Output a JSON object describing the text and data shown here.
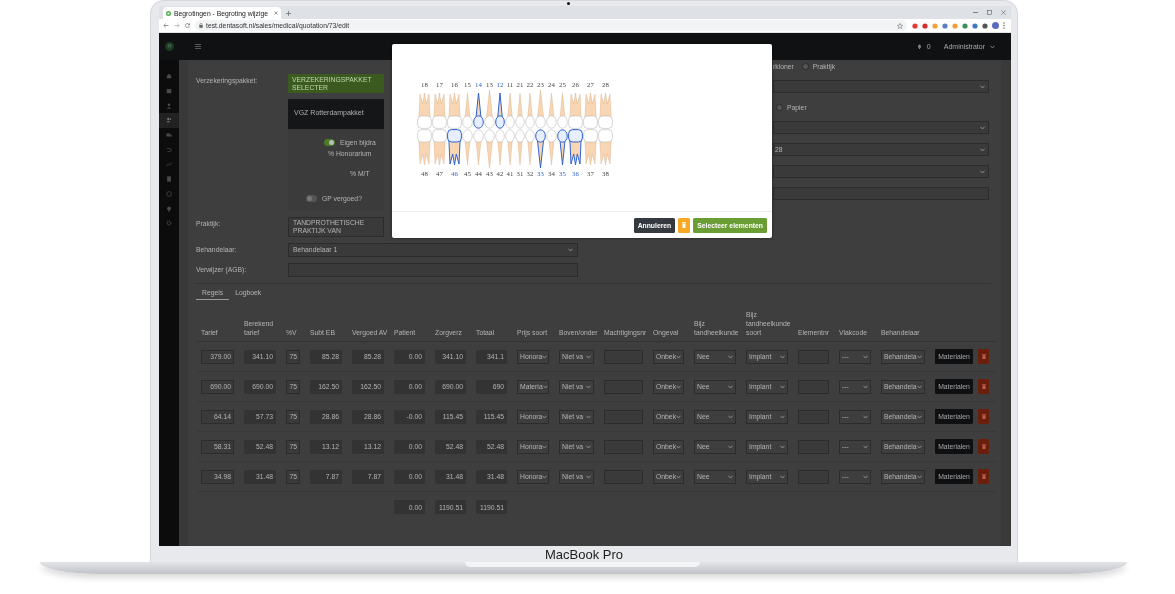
{
  "browser": {
    "tab_title": "Begrotingen - Begroting wijzige",
    "url": "test.dentasoft.nl/sales/medical/quotation/73/edit"
  },
  "navbar": {
    "notification_count": "0",
    "user": "Administrator"
  },
  "sidebar": {
    "items": [
      {
        "selected": false
      },
      {
        "selected": false
      },
      {
        "selected": false
      },
      {
        "selected": true
      },
      {
        "selected": false
      },
      {
        "selected": false
      },
      {
        "selected": false
      },
      {
        "selected": false
      },
      {
        "selected": false
      },
      {
        "selected": false
      },
      {
        "selected": false
      }
    ]
  },
  "form": {
    "insurance": {
      "label": "Verzekeringspakket:",
      "button": "VERZEKERINGSPAKKET SELECTER"
    },
    "package_card": {
      "title": "VGZ Rotterdampakket",
      "own_contribution": {
        "label": "Eigen bijdra",
        "on": true
      },
      "fee_label": "% Honorarium",
      "mt_label": "% M/T",
      "gp_reimbursed": {
        "label": "GP vergoed?",
        "on": false
      }
    },
    "practice": {
      "label": "Praktijk:",
      "value": "TANDPROTHETISCHE PRAKTIJK VAN"
    },
    "practitioner": {
      "label": "Behandelaar:",
      "value": "Behandelaar 1"
    },
    "referrer": {
      "label": "Verwijzer (AGB):"
    },
    "right_column": [
      {
        "kind": "radio",
        "leading_text": "rkloner",
        "label": "Praktijk",
        "selected": false
      },
      {
        "kind": "select"
      },
      {
        "kind": "radio",
        "label": "Papier",
        "selected": false
      },
      {
        "kind": "select"
      },
      {
        "kind": "select",
        "value": "28"
      },
      {
        "kind": "select"
      },
      {
        "kind": "input"
      }
    ]
  },
  "tabs": [
    {
      "label": "Regels",
      "selected": true
    },
    {
      "label": "Logboek",
      "selected": false
    }
  ],
  "table": {
    "columns": [
      {
        "label": "Tarief",
        "kind": "input"
      },
      {
        "label": "Berekend tarief",
        "kind": "readonly"
      },
      {
        "label": "%V",
        "kind": "input"
      },
      {
        "label": "Subt EB",
        "kind": "readonly"
      },
      {
        "label": "Vergoed AV",
        "kind": "readonly"
      },
      {
        "label": "Patient",
        "kind": "readonly"
      },
      {
        "label": "Zorgverz",
        "kind": "readonly"
      },
      {
        "label": "Totaal",
        "kind": "readonly"
      },
      {
        "label": "Prijs soort",
        "kind": "select"
      },
      {
        "label": "Boven/onder",
        "kind": "select"
      },
      {
        "label": "Machtigingsnr",
        "kind": "input"
      },
      {
        "label": "Ongeval",
        "kind": "select"
      },
      {
        "label": "Bijz tandheelkunde",
        "kind": "select"
      },
      {
        "label": "Bijz tandheelkunde soort",
        "kind": "select"
      },
      {
        "label": "Elementnr",
        "kind": "input"
      },
      {
        "label": "Vlakcode",
        "kind": "select"
      },
      {
        "label": "Behandelaar",
        "kind": "select"
      }
    ],
    "rows": [
      {
        "cells": [
          "379.00",
          "341.10",
          "75",
          "85.28",
          "85.28",
          "0.00",
          "341.10",
          "341.1",
          "Honora",
          "Niet va",
          null,
          "Onbek",
          "Nee",
          "Implant",
          null,
          "---",
          "Behandela"
        ],
        "button": "Materialen"
      },
      {
        "cells": [
          "690.00",
          "690.00",
          "75",
          "162.50",
          "162.50",
          "0.00",
          "690.00",
          "690",
          "Materia",
          "Niet va",
          null,
          "Onbek",
          "Nee",
          "Implant",
          null,
          "---",
          "Behandela"
        ],
        "button": "Materialen"
      },
      {
        "cells": [
          "64.14",
          "57.73",
          "75",
          "28.86",
          "28.86",
          "-0.00",
          "115.45",
          "115.45",
          "Honora",
          "Niet va",
          null,
          "Onbek",
          "Nee",
          "Implant",
          null,
          "---",
          "Behandela"
        ],
        "button": "Materialen"
      },
      {
        "cells": [
          "58.31",
          "52.48",
          "75",
          "13.12",
          "13.12",
          "0.00",
          "52.48",
          "52.48",
          "Honora",
          "Niet va",
          null,
          "Onbek",
          "Nee",
          "Implant",
          null,
          "---",
          "Behandela"
        ],
        "button": "Materialen"
      },
      {
        "cells": [
          "34.98",
          "31.48",
          "75",
          "7.87",
          "7.87",
          "0.00",
          "31.48",
          "31.48",
          "Honora",
          "Niet va",
          null,
          "Onbek",
          "Nee",
          "Implant",
          null,
          "---",
          "Behandela"
        ],
        "button": "Materialen"
      }
    ],
    "totals": [
      "0.00",
      "1190.51",
      "1190.51"
    ]
  },
  "modal": {
    "upper_teeth": [
      {
        "number": "18",
        "selected": false
      },
      {
        "number": "17",
        "selected": false
      },
      {
        "number": "16",
        "selected": false
      },
      {
        "number": "15",
        "selected": false
      },
      {
        "number": "14",
        "selected": true
      },
      {
        "number": "13",
        "selected": false
      },
      {
        "number": "12",
        "selected": true
      },
      {
        "number": "11",
        "selected": false
      },
      {
        "number": "21",
        "selected": false
      },
      {
        "number": "22",
        "selected": false
      },
      {
        "number": "23",
        "selected": false
      },
      {
        "number": "24",
        "selected": false
      },
      {
        "number": "25",
        "selected": false
      },
      {
        "number": "26",
        "selected": false
      },
      {
        "number": "27",
        "selected": false
      },
      {
        "number": "28",
        "selected": false
      }
    ],
    "lower_teeth": [
      {
        "number": "48",
        "selected": false
      },
      {
        "number": "47",
        "selected": false
      },
      {
        "number": "46",
        "selected": true
      },
      {
        "number": "45",
        "selected": false
      },
      {
        "number": "44",
        "selected": false
      },
      {
        "number": "43",
        "selected": false
      },
      {
        "number": "42",
        "selected": false
      },
      {
        "number": "41",
        "selected": false
      },
      {
        "number": "31",
        "selected": false
      },
      {
        "number": "32",
        "selected": false
      },
      {
        "number": "33",
        "selected": true
      },
      {
        "number": "34",
        "selected": false
      },
      {
        "number": "35",
        "selected": true
      },
      {
        "number": "36",
        "selected": true
      },
      {
        "number": "37",
        "selected": false
      },
      {
        "number": "38",
        "selected": false
      }
    ],
    "buttons": [
      {
        "kind": "cancel",
        "label": "Annuleren"
      },
      {
        "kind": "delete"
      },
      {
        "kind": "confirm",
        "label": "Selecteer elementen"
      }
    ]
  },
  "device_label": "MacBook Pro"
}
